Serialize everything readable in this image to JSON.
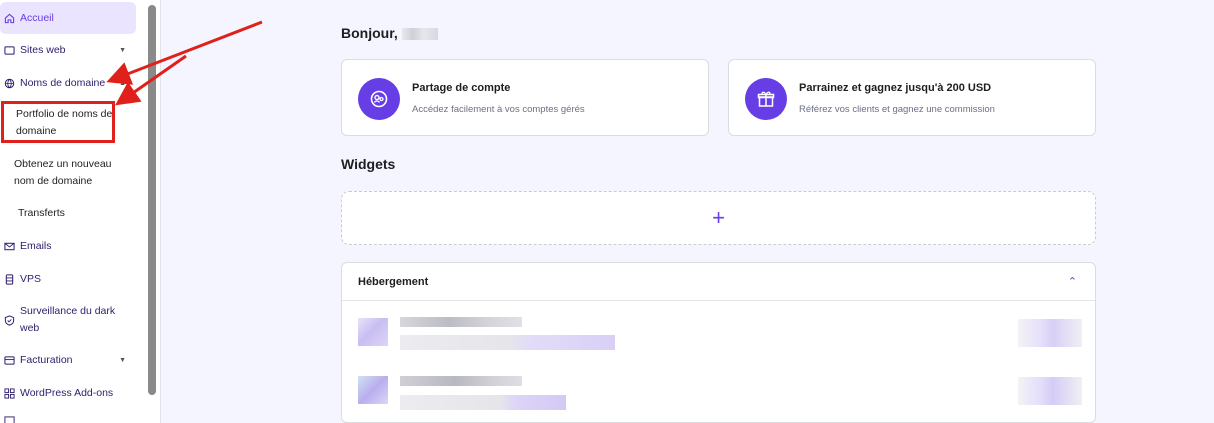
{
  "sidebar": {
    "items": [
      {
        "label": "Accueil",
        "icon": "home-icon"
      },
      {
        "label": "Sites web",
        "icon": "window-icon"
      },
      {
        "label": "Noms de domaine",
        "icon": "globe-icon"
      },
      {
        "label": "Emails",
        "icon": "mail-icon"
      },
      {
        "label": "VPS",
        "icon": "server-icon"
      },
      {
        "label": "Surveillance du dark web",
        "icon": "shield-icon"
      },
      {
        "label": "Facturation",
        "icon": "billing-icon"
      },
      {
        "label": "WordPress Add-ons",
        "icon": "grid-icon"
      }
    ],
    "subitems": [
      {
        "label": "Portfolio de noms de domaine"
      },
      {
        "label": "Obtenez un nouveau nom de domaine"
      },
      {
        "label": "Transferts"
      }
    ]
  },
  "main": {
    "greeting": "Bonjour,",
    "cards": [
      {
        "title": "Partage de compte",
        "desc": "Accédez facilement à vos comptes gérés",
        "icon": "account-share-icon"
      },
      {
        "title": "Parrainez et gagnez jusqu'à 200 USD",
        "desc": "Référez vos clients et gagnez une commission",
        "icon": "gift-icon"
      }
    ],
    "widgets_title": "Widgets",
    "add_widget": "+",
    "hosting_title": "Hébergement"
  },
  "colors": {
    "accent": "#673de6",
    "annotation": "#e0201b"
  }
}
